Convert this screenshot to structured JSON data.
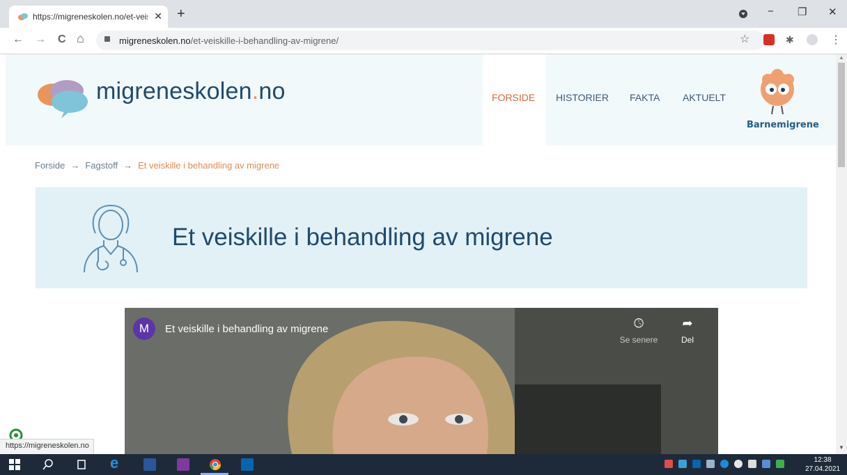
{
  "browser": {
    "tab_title": "https://migreneskolen.no/et-veis",
    "tab_close": "✕",
    "new_tab": "+",
    "url_host": "migreneskolen.no",
    "url_path": "/et-veiskille-i-behandling-av-migrene/",
    "minimize": "−",
    "restore": "❐",
    "close": "✕",
    "back": "←",
    "forward": "→",
    "reload": "C",
    "home": "⌂",
    "star": "☆",
    "menu": "⋮"
  },
  "site": {
    "logo_name": "migreneskolen",
    "logo_dot": ".",
    "logo_tld": "no",
    "nav": [
      "FORSIDE",
      "HISTORIER",
      "FAKTA",
      "AKTUELT"
    ],
    "kids_label": "Barnemigrene",
    "breadcrumb": [
      "Forside",
      "Fagstoff",
      "Et veiskille i behandling av migrene"
    ],
    "breadcrumb_arrow": "→",
    "hero_title": "Et veiskille i behandling av migrene",
    "colors": {
      "accent": "#e08a55",
      "brand": "#1f4a6b",
      "hero_bg": "#e2f1f6",
      "header_bg": "#f2f9fb"
    }
  },
  "video": {
    "channel_initial": "M",
    "title": "Et veiskille i behandling av migrene",
    "watch_later": "Se senere",
    "share": "Del"
  },
  "status_bar": "https://migreneskolen.no",
  "clock": {
    "time": "12:38",
    "date": "27.04.2021"
  }
}
